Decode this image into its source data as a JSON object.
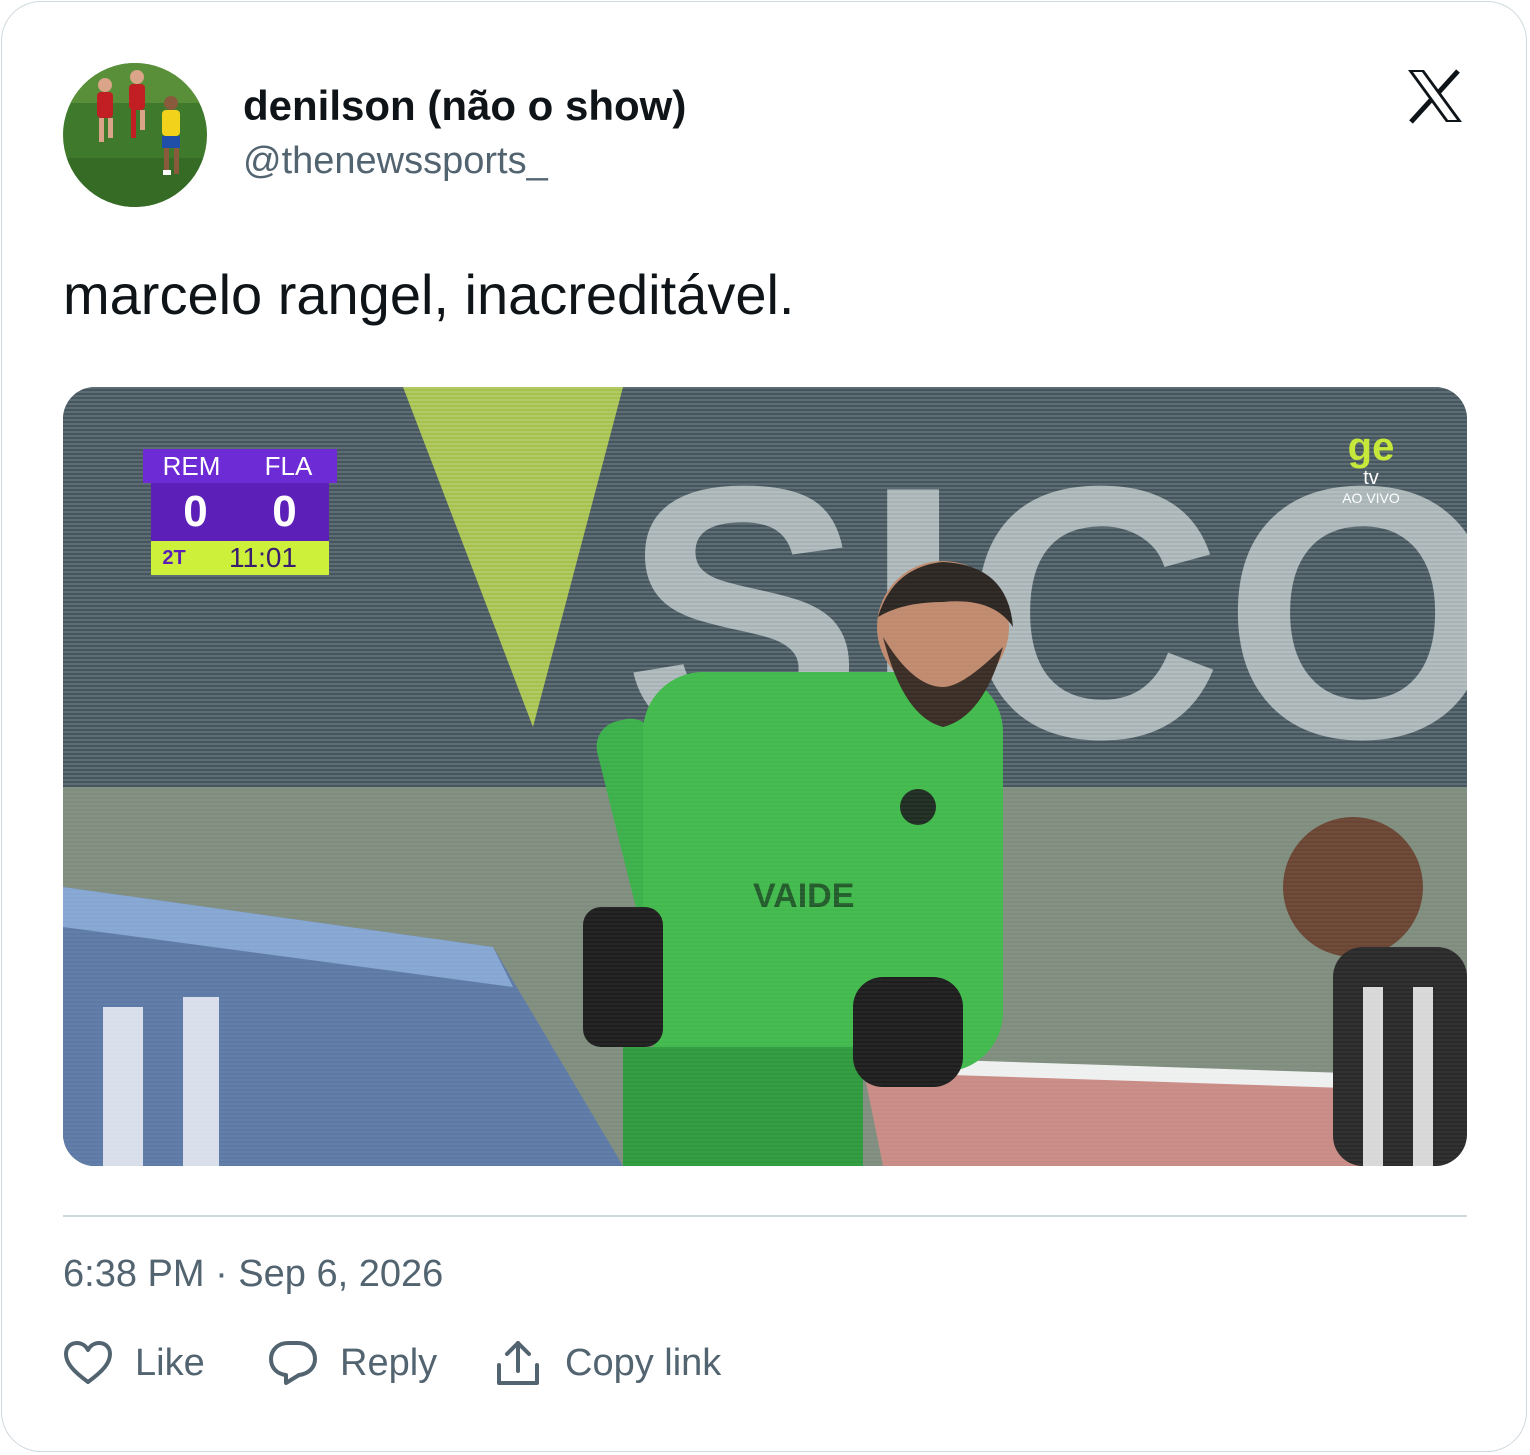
{
  "author": {
    "display_name": "denilson (não o show)",
    "handle": "@thenewssports_",
    "avatar_icon": "football-players-photo"
  },
  "brand": {
    "icon": "x-logo-icon"
  },
  "tweet": {
    "text": "marcelo rangel, inacreditável.",
    "timestamp": "6:38 PM · Sep 6, 2026"
  },
  "media": {
    "scoreboard": {
      "home_team": "REM",
      "away_team": "FLA",
      "home_score": "0",
      "away_score": "0",
      "period": "2T",
      "clock": "11:01"
    },
    "broadcaster": {
      "brand": "ge",
      "sub": "tv",
      "live": "AO VIVO"
    }
  },
  "actions": {
    "like_label": "Like",
    "reply_label": "Reply",
    "copy_label": "Copy link"
  },
  "colors": {
    "text_primary": "#0f1419",
    "text_secondary": "#536471",
    "border": "#cfd9de"
  }
}
